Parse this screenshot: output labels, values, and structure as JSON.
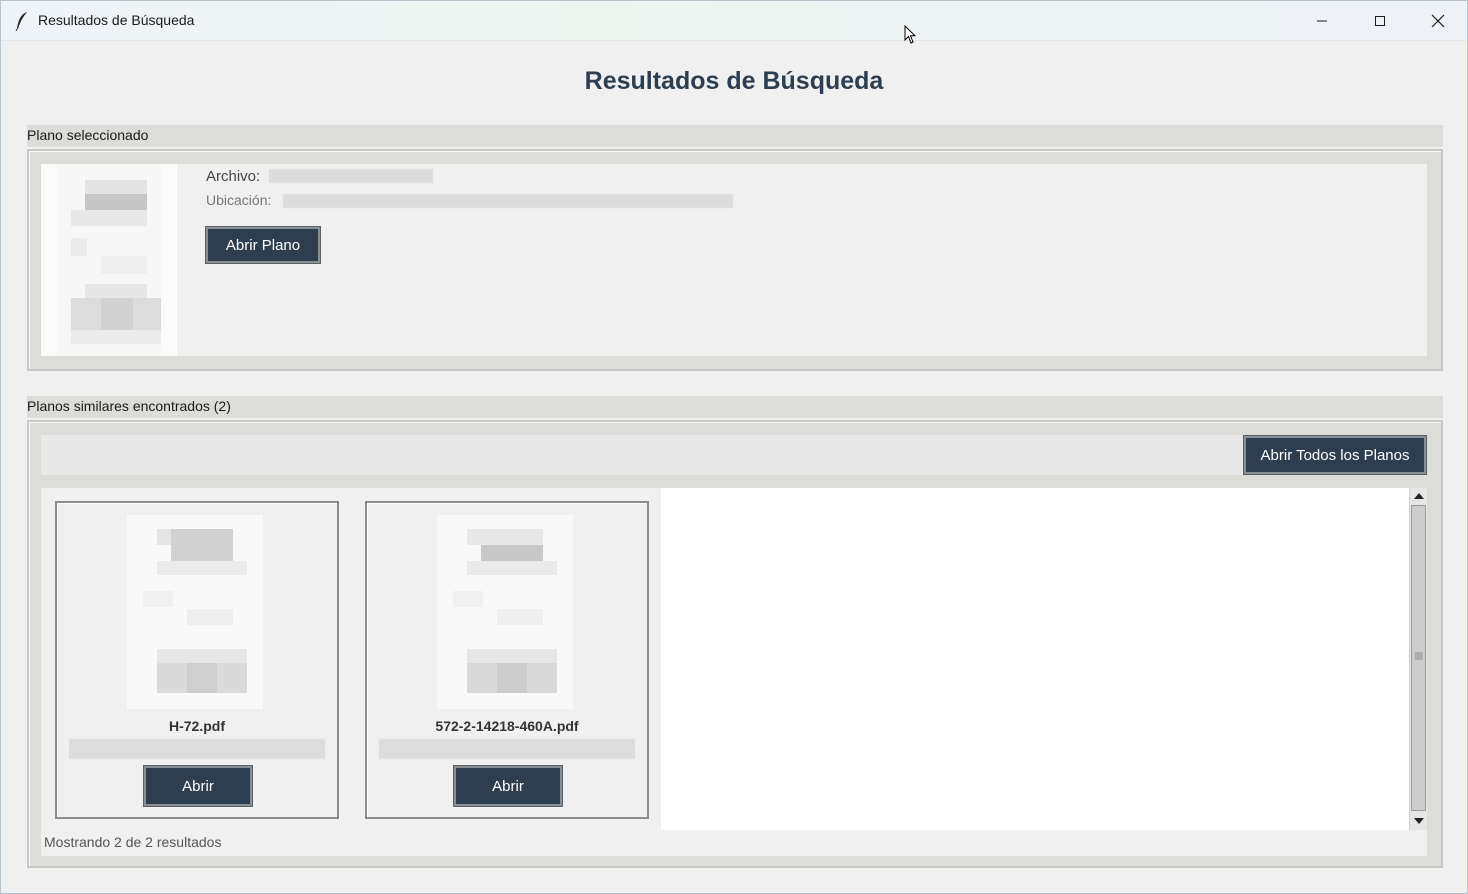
{
  "window": {
    "title": "Resultados de Búsqueda"
  },
  "page": {
    "heading": "Resultados de Búsqueda"
  },
  "selected": {
    "group_label": "Plano seleccionado",
    "archivo_label": "Archivo:",
    "ubicacion_label": "Ubicación:",
    "open_button": "Abrir Plano"
  },
  "similar": {
    "group_label": "Planos similares encontrados (2)",
    "open_all_button": "Abrir Todos los Planos",
    "results": [
      {
        "filename": "H-72.pdf",
        "open_button": "Abrir"
      },
      {
        "filename": "572-2-14218-460A.pdf",
        "open_button": "Abrir"
      }
    ],
    "status": "Mostrando 2 de 2 resultados"
  },
  "colors": {
    "button_bg": "#2c3e50",
    "title_color": "#2c3e50"
  }
}
